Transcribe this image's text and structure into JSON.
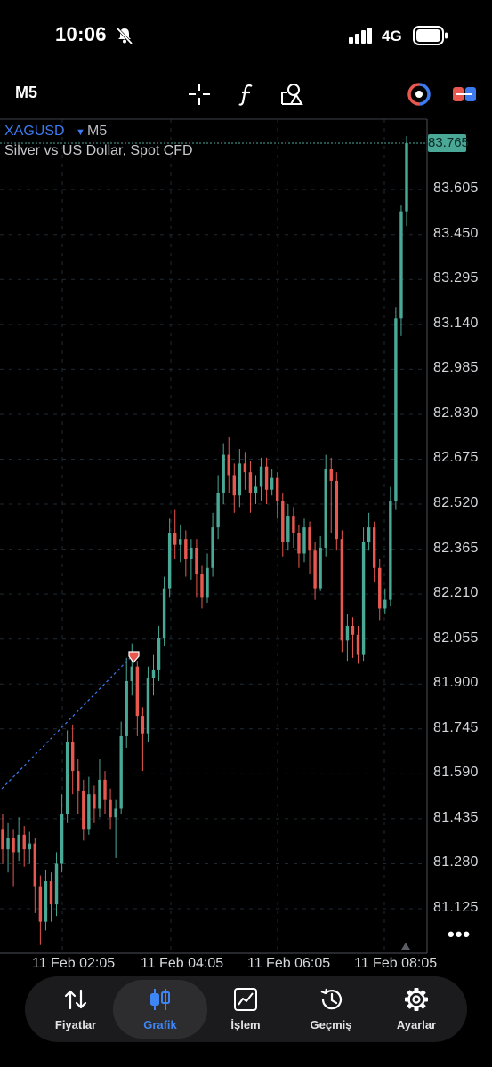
{
  "status_bar": {
    "time": "10:06",
    "network": "4G"
  },
  "toolbar": {
    "timeframe": "M5",
    "icons": [
      "crosshair-icon",
      "function-icon",
      "objects-icon",
      "refresh-icon",
      "trade-panel-icon"
    ]
  },
  "chart_data": {
    "type": "candlestick",
    "symbol": "XAGUSD",
    "timeframe": "M5",
    "description": "Silver vs US Dollar, Spot CFD",
    "current_price": "83.765",
    "y_ticks": [
      "83.605",
      "83.450",
      "83.295",
      "83.140",
      "82.985",
      "82.830",
      "82.675",
      "82.520",
      "82.365",
      "82.210",
      "82.055",
      "81.900",
      "81.745",
      "81.590",
      "81.435",
      "81.280",
      "81.125"
    ],
    "x_ticks": [
      "11 Feb 02:05",
      "11 Feb 04:05",
      "11 Feb 06:05",
      "11 Feb 08:05"
    ],
    "ylim": [
      81.02,
      83.82
    ],
    "candles": [
      [
        81.4,
        81.33,
        81.45,
        81.28
      ],
      [
        81.33,
        81.37,
        81.42,
        81.25
      ],
      [
        81.37,
        81.32,
        81.4,
        81.2
      ],
      [
        81.32,
        81.38,
        81.44,
        81.29
      ],
      [
        81.38,
        81.33,
        81.41,
        81.27
      ],
      [
        81.33,
        81.35,
        81.39,
        81.28
      ],
      [
        81.35,
        81.2,
        81.37,
        81.11
      ],
      [
        81.2,
        81.08,
        81.24,
        81.0
      ],
      [
        81.08,
        81.22,
        81.26,
        81.05
      ],
      [
        81.22,
        81.14,
        81.25,
        81.08
      ],
      [
        81.14,
        81.28,
        81.32,
        81.1
      ],
      [
        81.28,
        81.45,
        81.52,
        81.25
      ],
      [
        81.45,
        81.7,
        81.74,
        81.42
      ],
      [
        81.7,
        81.6,
        81.76,
        81.52
      ],
      [
        81.6,
        81.53,
        81.64,
        81.45
      ],
      [
        81.53,
        81.4,
        81.57,
        81.36
      ],
      [
        81.4,
        81.52,
        81.58,
        81.38
      ],
      [
        81.52,
        81.47,
        81.55,
        81.42
      ],
      [
        81.47,
        81.57,
        81.64,
        81.44
      ],
      [
        81.57,
        81.5,
        81.6,
        81.45
      ],
      [
        81.5,
        81.44,
        81.54,
        81.4
      ],
      [
        81.44,
        81.47,
        81.5,
        81.3
      ],
      [
        81.47,
        81.72,
        81.77,
        81.45
      ],
      [
        81.72,
        81.91,
        81.99,
        81.68
      ],
      [
        81.91,
        81.96,
        82.04,
        81.86
      ],
      [
        81.96,
        81.79,
        81.98,
        81.72
      ],
      [
        81.79,
        81.73,
        81.82,
        81.6
      ],
      [
        81.73,
        81.92,
        81.96,
        81.7
      ],
      [
        81.92,
        81.95,
        82.0,
        81.86
      ],
      [
        81.95,
        82.06,
        82.1,
        81.91
      ],
      [
        82.06,
        82.23,
        82.27,
        82.03
      ],
      [
        82.23,
        82.42,
        82.47,
        82.2
      ],
      [
        82.42,
        82.38,
        82.5,
        82.33
      ],
      [
        82.38,
        82.4,
        82.45,
        82.32
      ],
      [
        82.4,
        82.33,
        82.43,
        82.27
      ],
      [
        82.33,
        82.37,
        82.4,
        82.26
      ],
      [
        82.37,
        82.28,
        82.4,
        82.2
      ],
      [
        82.28,
        82.2,
        82.31,
        82.16
      ],
      [
        82.2,
        82.3,
        82.35,
        82.18
      ],
      [
        82.3,
        82.44,
        82.49,
        82.27
      ],
      [
        82.44,
        82.56,
        82.62,
        82.4
      ],
      [
        82.56,
        82.69,
        82.73,
        82.52
      ],
      [
        82.69,
        82.62,
        82.75,
        82.56
      ],
      [
        82.62,
        82.55,
        82.66,
        82.49
      ],
      [
        82.55,
        82.66,
        82.71,
        82.51
      ],
      [
        82.66,
        82.63,
        82.7,
        82.57
      ],
      [
        82.63,
        82.56,
        82.67,
        82.49
      ],
      [
        82.56,
        82.58,
        82.62,
        82.52
      ],
      [
        82.58,
        82.65,
        82.68,
        82.53
      ],
      [
        82.65,
        82.57,
        82.68,
        82.52
      ],
      [
        82.57,
        82.61,
        82.64,
        82.55
      ],
      [
        82.61,
        82.53,
        82.63,
        82.47
      ],
      [
        82.53,
        82.39,
        82.56,
        82.34
      ],
      [
        82.39,
        82.48,
        82.52,
        82.36
      ],
      [
        82.48,
        82.42,
        82.51,
        82.37
      ],
      [
        82.42,
        82.35,
        82.45,
        82.3
      ],
      [
        82.35,
        82.44,
        82.47,
        82.32
      ],
      [
        82.44,
        82.36,
        82.46,
        82.28
      ],
      [
        82.36,
        82.23,
        82.39,
        82.19
      ],
      [
        82.23,
        82.37,
        82.41,
        82.22
      ],
      [
        82.37,
        82.64,
        82.69,
        82.34
      ],
      [
        82.64,
        82.6,
        82.68,
        82.42
      ],
      [
        82.6,
        82.4,
        82.63,
        82.36
      ],
      [
        82.4,
        82.05,
        82.43,
        82.01
      ],
      [
        82.05,
        82.1,
        82.14,
        81.98
      ],
      [
        82.1,
        82.07,
        82.13,
        81.99
      ],
      [
        82.07,
        82.0,
        82.1,
        81.97
      ],
      [
        82.0,
        82.39,
        82.44,
        81.98
      ],
      [
        82.39,
        82.44,
        82.49,
        82.36
      ],
      [
        82.44,
        82.3,
        82.46,
        82.25
      ],
      [
        82.3,
        82.16,
        82.33,
        82.12
      ],
      [
        82.16,
        82.19,
        82.23,
        82.14
      ],
      [
        82.19,
        82.53,
        82.58,
        82.17
      ],
      [
        82.53,
        83.16,
        83.2,
        82.5
      ],
      [
        83.16,
        83.53,
        83.55,
        83.1
      ],
      [
        83.53,
        83.765,
        83.79,
        83.48
      ]
    ]
  },
  "nav": {
    "items": [
      {
        "label": "Fiyatlar",
        "icon": "quotes-icon"
      },
      {
        "label": "Grafik",
        "icon": "chart-icon"
      },
      {
        "label": "İşlem",
        "icon": "trade-icon"
      },
      {
        "label": "Geçmiş",
        "icon": "history-icon"
      },
      {
        "label": "Ayarlar",
        "icon": "settings-icon"
      }
    ],
    "active": "Grafik",
    "accent": "#3e86f5"
  },
  "colors": {
    "bull": "#4aa897",
    "bear": "#e8584f",
    "accent": "#3e7bf0"
  }
}
